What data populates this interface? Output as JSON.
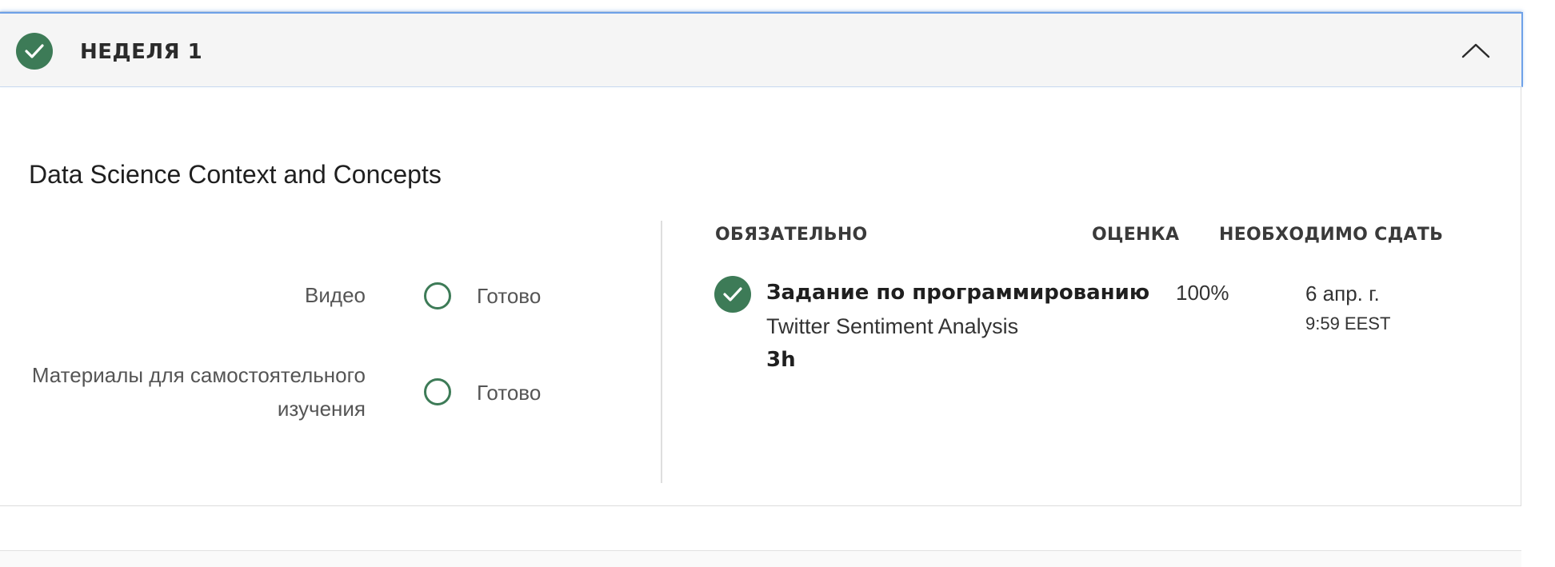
{
  "week": {
    "title": "НЕДЕЛЯ 1",
    "completed": true,
    "expanded": true
  },
  "module": {
    "title": "Data Science Context and Concepts"
  },
  "progress_rows": [
    {
      "label": "Видео",
      "status": "Готово"
    },
    {
      "label": "Материалы для самостоятельного изучения",
      "status": "Готово"
    }
  ],
  "columns": {
    "required": "ОБЯЗАТЕЛЬНО",
    "grade": "ОЦЕНКА",
    "due": "НЕОБХОДИМО СДАТЬ"
  },
  "assignment": {
    "completed": true,
    "type": "Задание по программированию",
    "name": "Twitter Sentiment Analysis",
    "duration": "3h",
    "grade": "100%",
    "due_date": "6 апр. г.",
    "due_time": "9:59 EEST"
  },
  "colors": {
    "accent_green": "#3d7b57",
    "header_bg": "#f5f5f5",
    "focus_border": "#6ea1e8"
  },
  "icons": {
    "week_status": "check-circle-icon",
    "toggle": "chevron-up-icon",
    "progress": "circle-outline-icon",
    "assignment_status": "check-circle-icon"
  }
}
